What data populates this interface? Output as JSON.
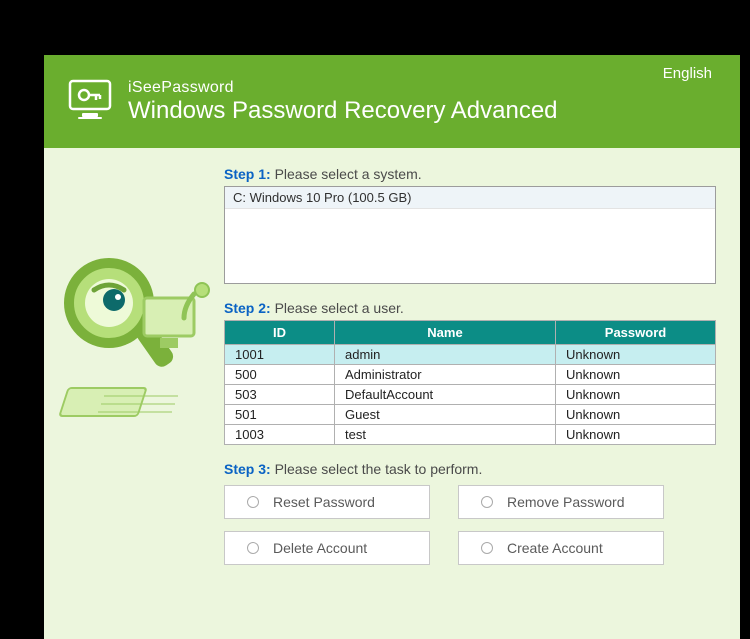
{
  "header": {
    "brand_small": "iSeePassword",
    "brand_big": "Windows Password Recovery Advanced",
    "language": "English"
  },
  "steps": {
    "s1_label": "Step 1:",
    "s1_text": " Please select a system.",
    "s2_label": "Step 2:",
    "s2_text": " Please select a user.",
    "s3_label": "Step 3:",
    "s3_text": " Please select the task to perform."
  },
  "systems": [
    {
      "label": "C: Windows 10 Pro (100.5 GB)"
    }
  ],
  "user_table": {
    "cols": {
      "id": "ID",
      "name": "Name",
      "password": "Password"
    },
    "rows": [
      {
        "id": "1001",
        "name": "admin",
        "password": "Unknown"
      },
      {
        "id": "500",
        "name": "Administrator",
        "password": "Unknown"
      },
      {
        "id": "503",
        "name": "DefaultAccount",
        "password": "Unknown"
      },
      {
        "id": "501",
        "name": "Guest",
        "password": "Unknown"
      },
      {
        "id": "1003",
        "name": "test",
        "password": "Unknown"
      }
    ]
  },
  "buttons": {
    "reset": "Reset Password",
    "remove": "Remove Password",
    "delete": "Delete Account",
    "create": "Create Account"
  }
}
